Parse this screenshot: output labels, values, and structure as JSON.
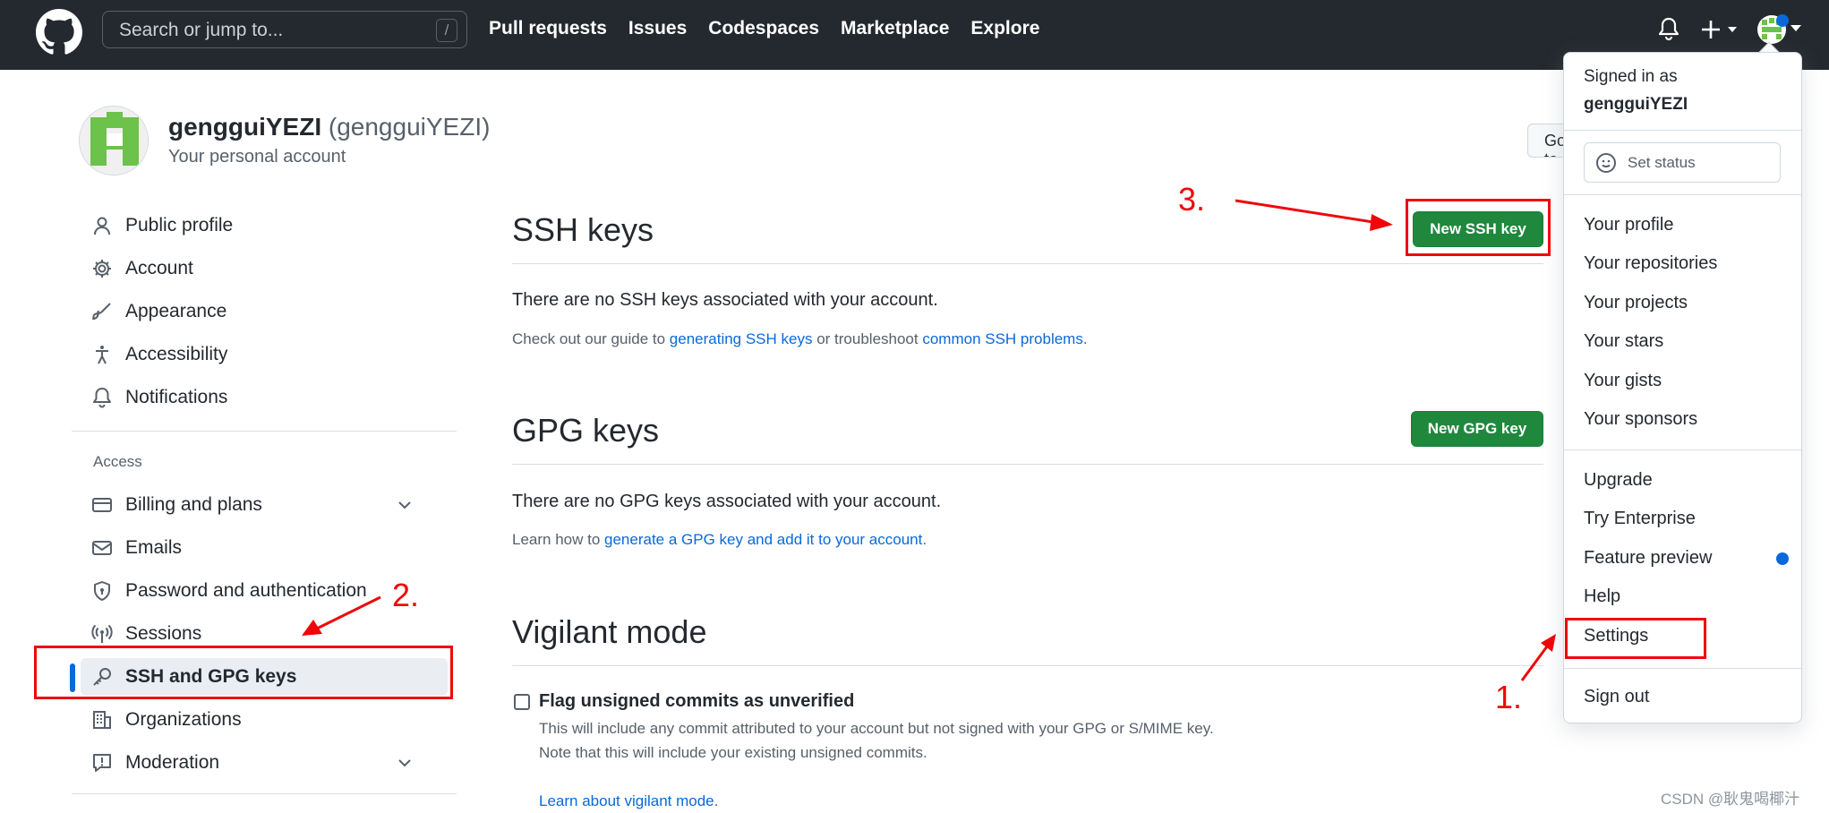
{
  "header": {
    "search_placeholder": "Search or jump to...",
    "search_shortcut": "/",
    "nav": [
      "Pull requests",
      "Issues",
      "Codespaces",
      "Marketplace",
      "Explore"
    ]
  },
  "profile": {
    "name": "gengguiYEZI",
    "login": "(gengguiYEZI)",
    "subtitle": "Your personal account",
    "go_button": "Go to your personal profile"
  },
  "sidebar": {
    "top_items": [
      "Public profile",
      "Account",
      "Appearance",
      "Accessibility",
      "Notifications"
    ],
    "access_heading": "Access",
    "access_items": [
      "Billing and plans",
      "Emails",
      "Password and authentication",
      "Sessions",
      "SSH and GPG keys",
      "Organizations",
      "Moderation"
    ]
  },
  "main": {
    "ssh": {
      "title": "SSH keys",
      "button": "New SSH key",
      "empty": "There are no SSH keys associated with your account.",
      "hint_prefix": "Check out our guide to ",
      "hint_link1": "generating SSH keys",
      "hint_middle": " or troubleshoot ",
      "hint_link2": "common SSH problems",
      "hint_suffix": "."
    },
    "gpg": {
      "title": "GPG keys",
      "button": "New GPG key",
      "empty": "There are no GPG keys associated with your account.",
      "hint_prefix": "Learn how to ",
      "hint_link": "generate a GPG key and add it to your account",
      "hint_suffix": "."
    },
    "vigilant": {
      "title": "Vigilant mode",
      "checkbox_label": "Flag unsigned commits as unverified",
      "desc1": "This will include any commit attributed to your account but not signed with your GPG or S/MIME key.",
      "desc2": "Note that this will include your existing unsigned commits.",
      "link": "Learn about vigilant mode",
      "link_suffix": "."
    }
  },
  "dropdown": {
    "signed_in_as": "Signed in as",
    "username": "gengguiYEZI",
    "set_status": "Set status",
    "group1": [
      "Your profile",
      "Your repositories",
      "Your projects",
      "Your stars",
      "Your gists",
      "Your sponsors"
    ],
    "group2": [
      "Upgrade",
      "Try Enterprise",
      "Feature preview",
      "Help",
      "Settings"
    ],
    "sign_out": "Sign out"
  },
  "annotations": {
    "step1": "1.",
    "step2": "2.",
    "step3": "3."
  },
  "watermark": "CSDN @耿鬼喝椰汁",
  "colors": {
    "header_bg": "#24292f",
    "primary_green": "#1f883d",
    "link_blue": "#0969da",
    "annotation_red": "#f0060a"
  }
}
